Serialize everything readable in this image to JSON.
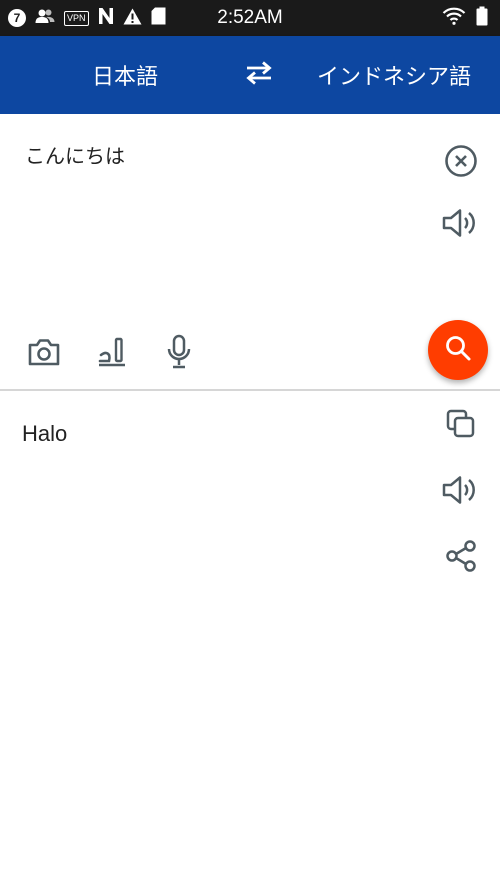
{
  "status_bar": {
    "notification_count": "7",
    "vpn_label": "VPN",
    "time": "2:52AM",
    "icons": [
      "notification-count-icon",
      "people-icon",
      "vpn-icon",
      "n-app-icon",
      "warning-icon",
      "sd-card-icon",
      "wifi-icon",
      "battery-icon"
    ]
  },
  "app_bar": {
    "source_language": "日本語",
    "target_language": "インドネシア語",
    "swap_icon": "swap-arrows-icon",
    "background_color": "#0d47a1"
  },
  "source": {
    "text": "こんにちは",
    "actions": [
      "clear-icon",
      "speaker-icon"
    ],
    "input_methods": [
      "camera-icon",
      "handwriting-icon",
      "microphone-icon"
    ],
    "search_icon": "search-icon",
    "search_button_color": "#ff3d00"
  },
  "result": {
    "text": "Halo",
    "actions": [
      "copy-icon",
      "speaker-icon",
      "share-icon"
    ]
  }
}
